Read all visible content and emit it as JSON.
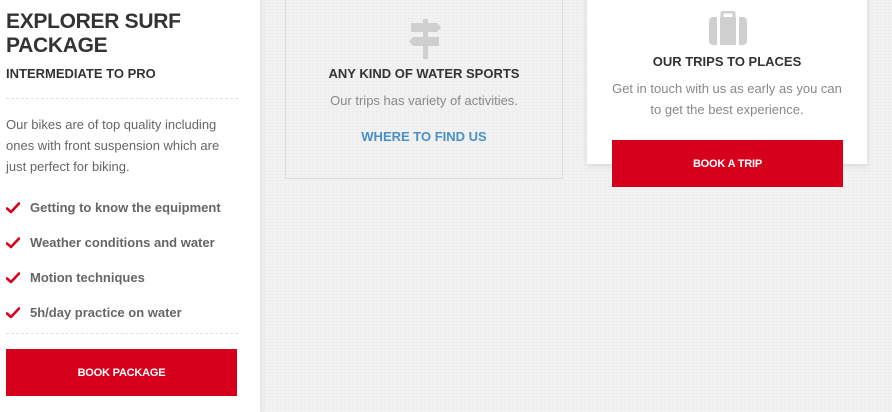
{
  "package": {
    "title": "EXPLORER SURF PACKAGE",
    "level": "INTERMEDIATE TO PRO",
    "description": "Our bikes are of top quality including ones with front suspension which are just perfect for biking.",
    "features": [
      "Getting to know the equipment",
      "Weather conditions and water",
      "Motion techniques",
      "5h/day practice on water"
    ],
    "check_icon": "check-icon",
    "book_label": "BOOK PACKAGE"
  },
  "water_sports": {
    "icon": "signpost-icon",
    "title": "ANY KIND OF WATER SPORTS",
    "text": "Our trips has variety of activities.",
    "link_label": "WHERE TO FIND US"
  },
  "trips": {
    "icon": "briefcase-icon",
    "title": "OUR TRIPS TO PLACES",
    "text": "Get in touch with us as early as you can to get the best experience.",
    "book_label": "BOOK A TRIP"
  },
  "colors": {
    "accent_red": "#d6001c",
    "link_blue": "#4a90c8",
    "heading": "#333333",
    "body_text": "#666666",
    "muted_text": "#888888",
    "icon_gray": "#cfcfcf"
  }
}
